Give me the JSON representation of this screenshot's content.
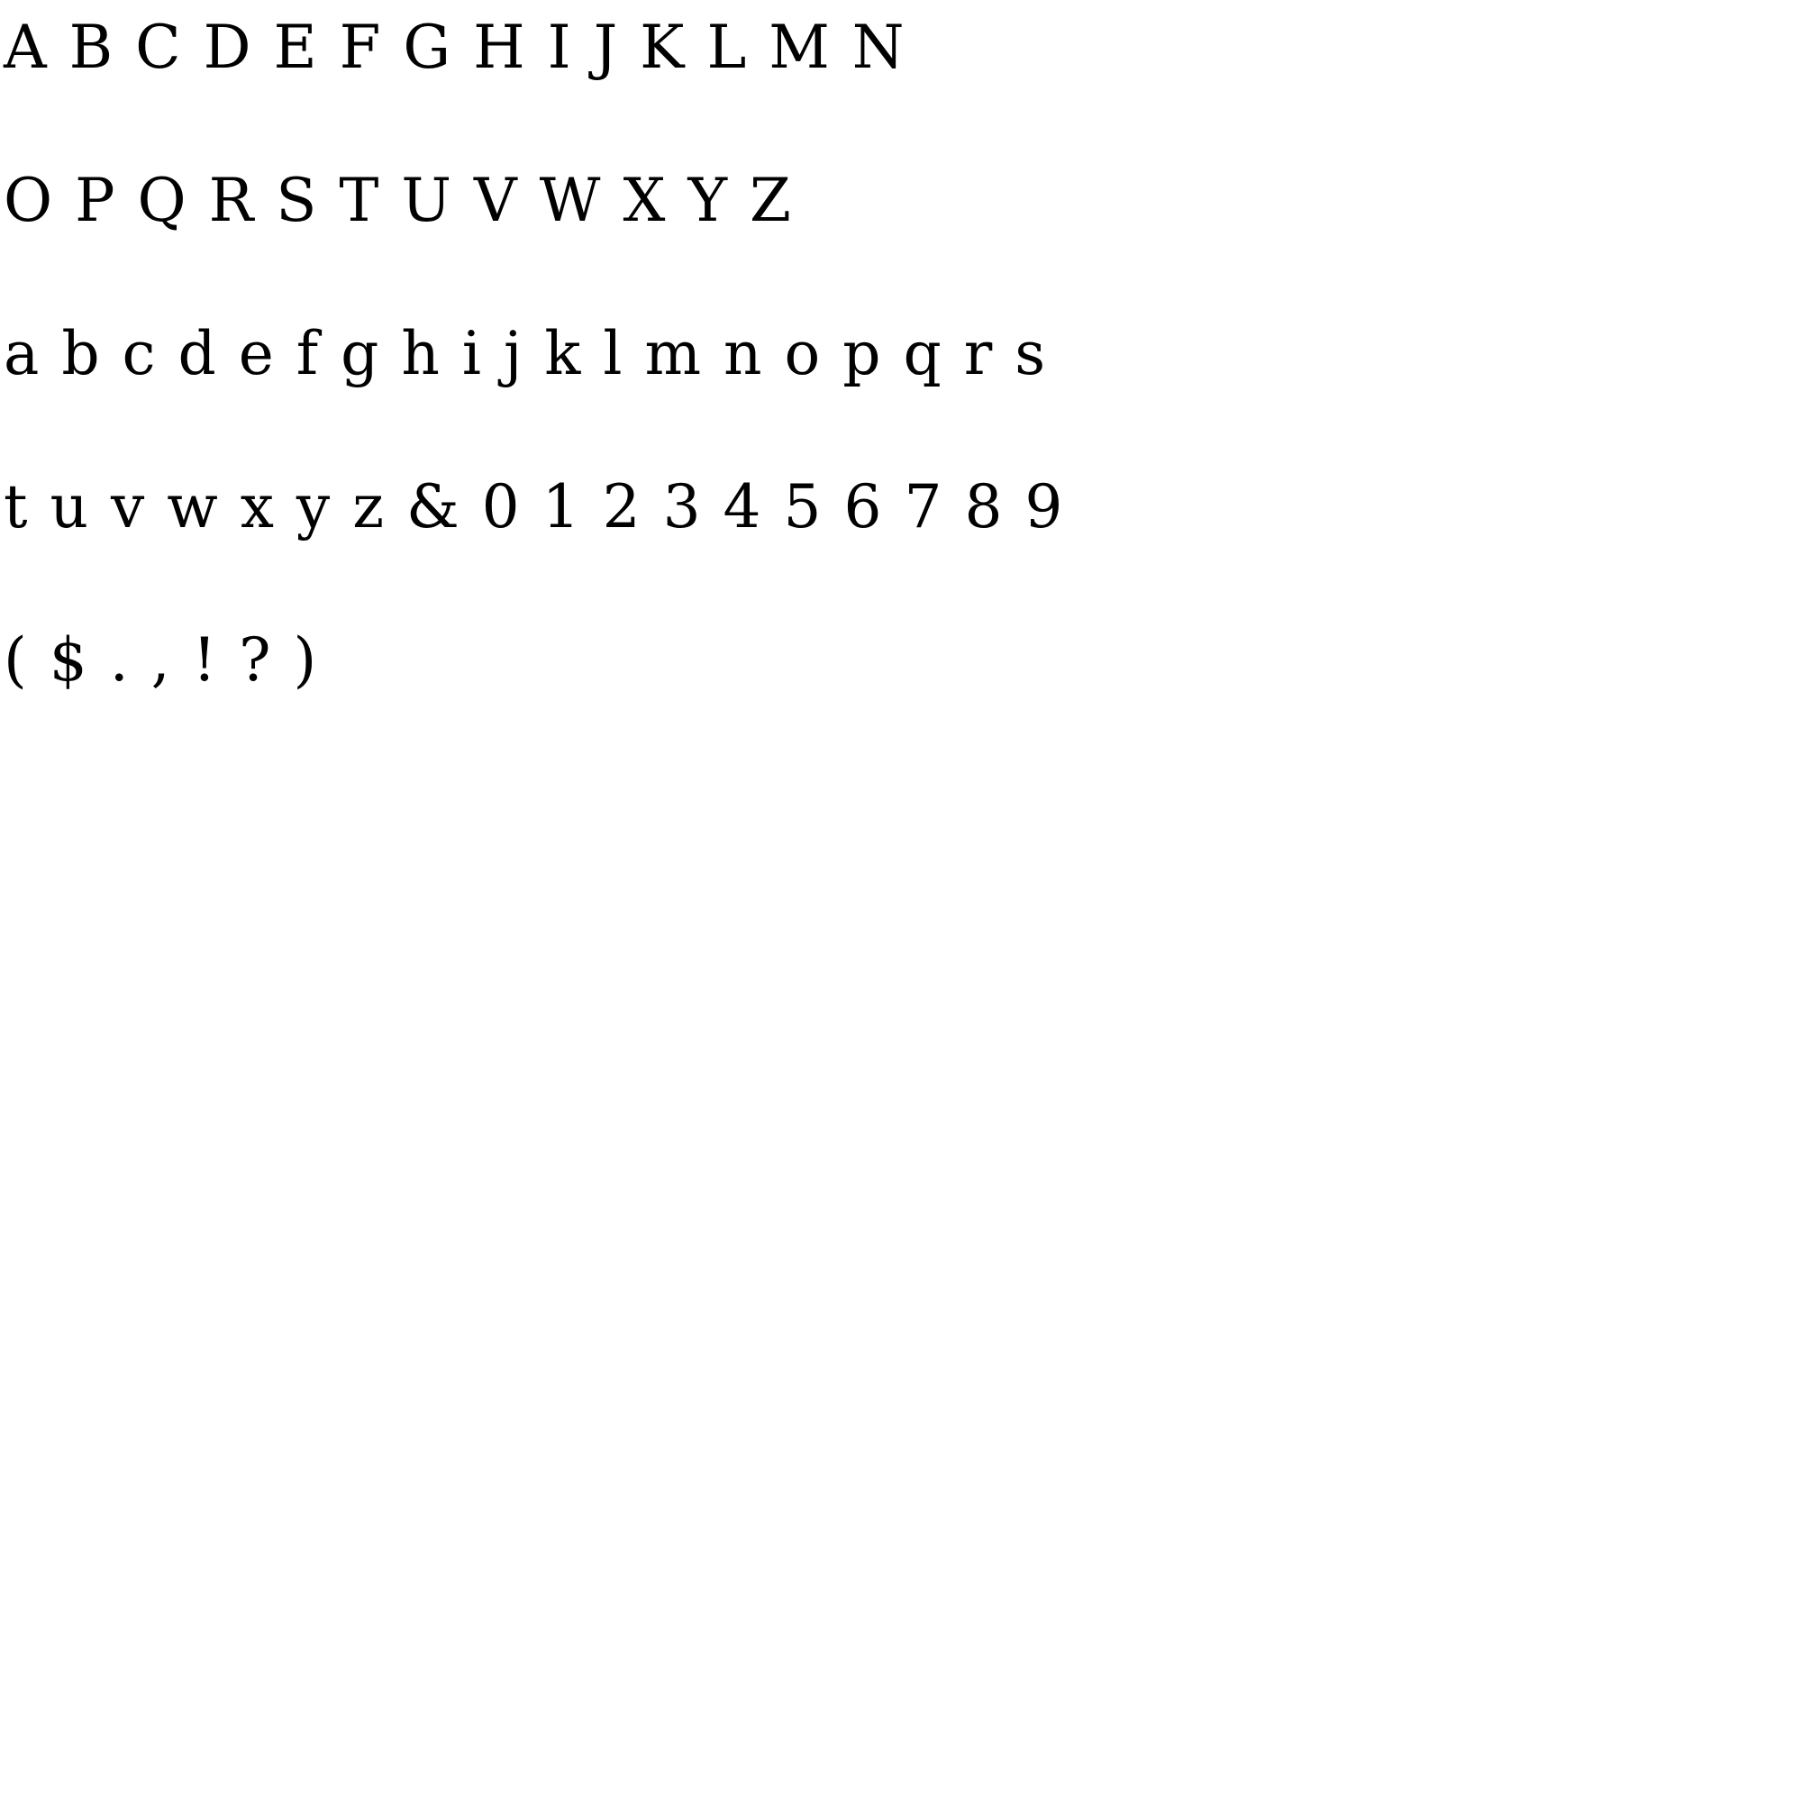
{
  "rows": [
    "A B C D E F G H I J K L M N",
    "O P Q R S T U V W X Y Z",
    "a b c d e f g h i j k l m n o p q r s",
    "t u v w x y z & 0 1 2 3 4 5 6 7 8 9",
    "( $ . , ! ? )"
  ]
}
